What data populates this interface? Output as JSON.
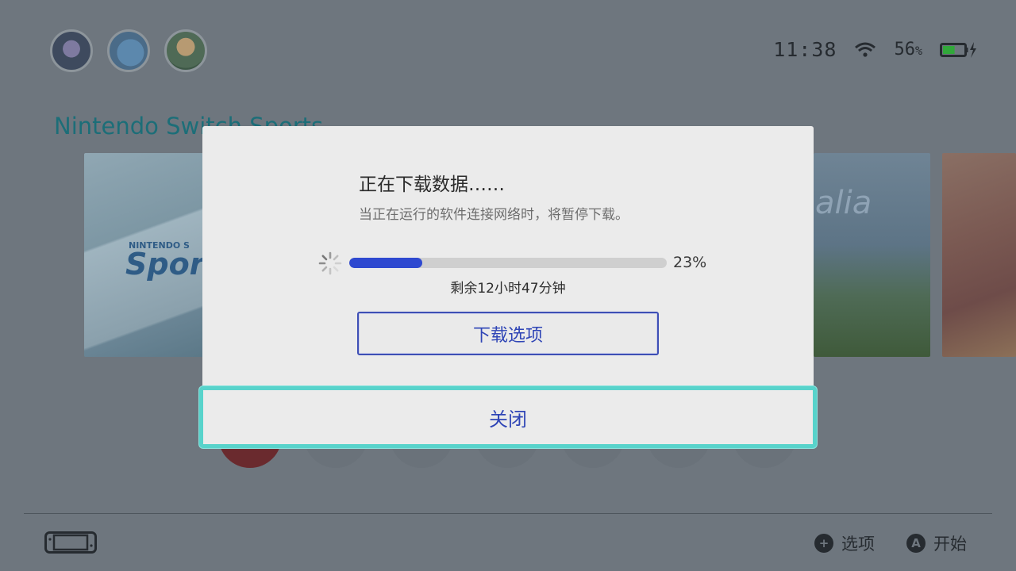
{
  "status_bar": {
    "time": "11:38",
    "battery_percent": "56",
    "battery_unit": "%",
    "wifi_icon": "wifi-icon",
    "battery_icon": "battery-charging-icon",
    "battery_level": 0.56
  },
  "home": {
    "selected_game_title": "Nintendo Switch Sports",
    "tile_texts": {
      "sports_small": "NINTENDO S",
      "sports_big": "Spor",
      "sky_partial": "alia"
    }
  },
  "dialog": {
    "title": "正在下载数据……",
    "subtitle": "当正在运行的软件连接网络时，将暂停下载。",
    "progress_percent": 23,
    "progress_label": "23%",
    "remaining": "剩余12小时47分钟",
    "options_button": "下载选项",
    "close_button": "关闭",
    "accent_color": "#2e49d0",
    "focus_color": "#58d3cb"
  },
  "footer": {
    "options": {
      "icon": "plus-button-icon",
      "glyph": "+",
      "label": "选项"
    },
    "start": {
      "icon": "a-button-icon",
      "glyph": "A",
      "label": "开始"
    },
    "console_icon": "handheld-console-icon"
  }
}
